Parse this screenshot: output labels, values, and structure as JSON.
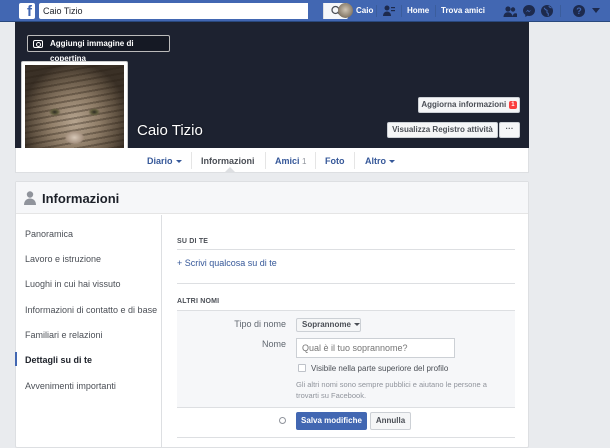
{
  "topbar": {
    "logo_letter": "f",
    "search_value": "Caio Tizio",
    "user_name": "Caio",
    "home_label": "Home",
    "find_friends_label": "Trova amici",
    "colors": {
      "bar": "#4267b2"
    }
  },
  "cover": {
    "add_cover_label": "Aggiungi immagine di copertina",
    "profile_name": "Caio Tizio",
    "update_info_label": "Aggiorna informazioni",
    "update_info_badge": "1",
    "activity_log_label": "Visualizza Registro attività",
    "more_label": "···"
  },
  "tabs": [
    {
      "label": "Diario"
    },
    {
      "label": "Informazioni"
    },
    {
      "label": "Amici",
      "count": "1"
    },
    {
      "label": "Foto"
    },
    {
      "label": "Altro"
    }
  ],
  "about": {
    "title": "Informazioni",
    "sidebar": [
      "Panoramica",
      "Lavoro e istruzione",
      "Luoghi in cui hai vissuto",
      "Informazioni di contatto e di base",
      "Familiari e relazioni",
      "Dettagli su di te",
      "Avvenimenti importanti"
    ],
    "active_index": 5,
    "about_you_heading": "SU DI TE",
    "write_about_link": "+ Scrivi qualcosa su di te",
    "other_names_heading": "ALTRI NOMI",
    "form": {
      "name_type_label": "Tipo di nome",
      "name_type_value": "Soprannome",
      "name_label": "Nome",
      "name_placeholder": "Qual è il tuo soprannome?",
      "show_on_top_label": "Visibile nella parte superiore del profilo",
      "note": "Gli altri nomi sono sempre pubblici e aiutano le persone a trovarti su Facebook.",
      "save_label": "Salva modifiche",
      "cancel_label": "Annulla"
    }
  }
}
